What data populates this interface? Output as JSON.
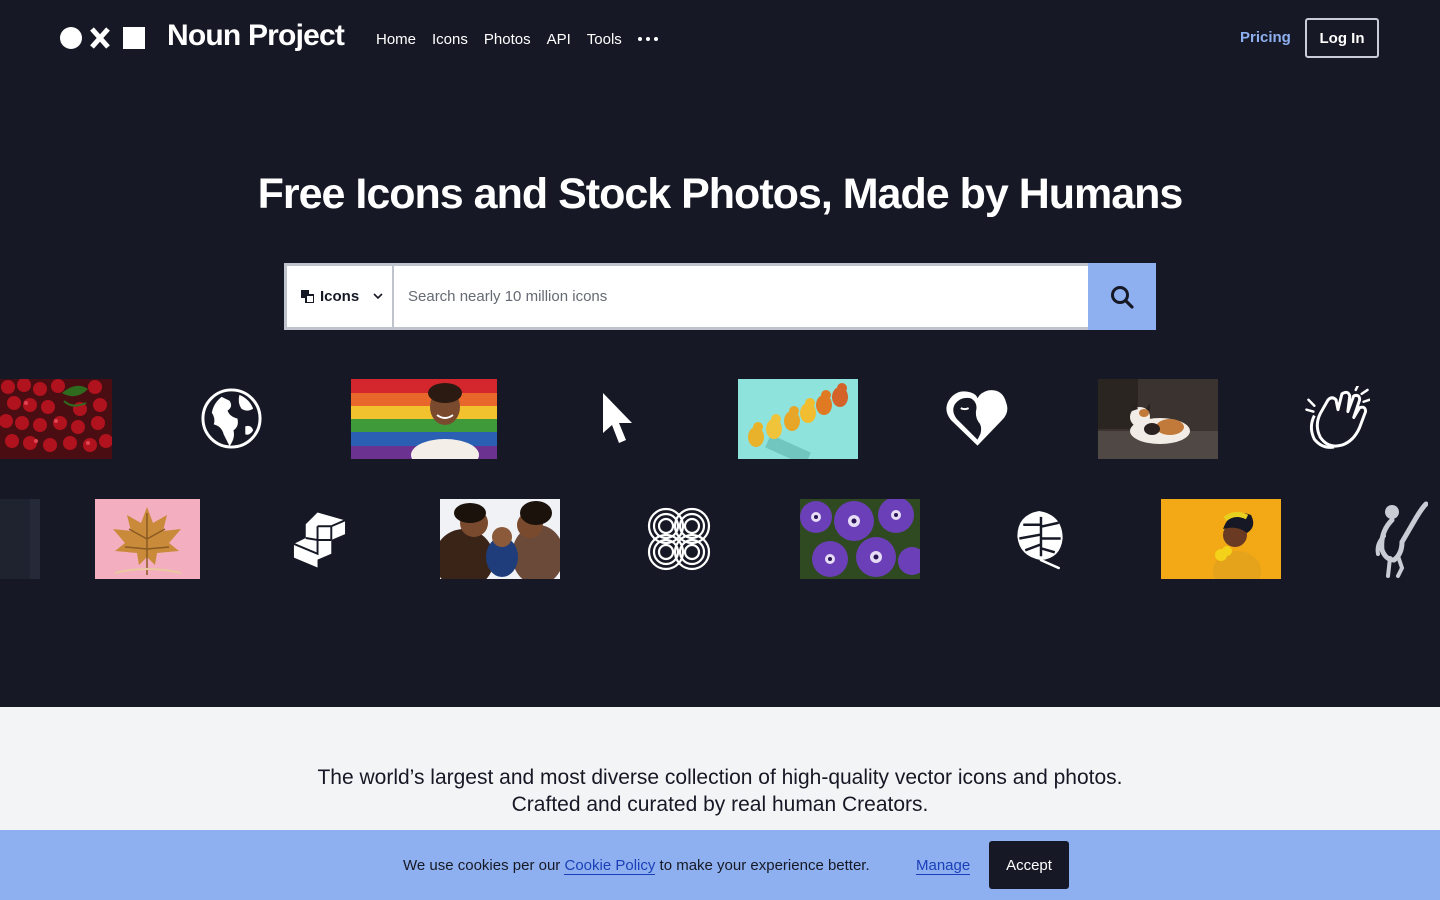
{
  "header": {
    "brand": "Noun Project",
    "nav": [
      "Home",
      "Icons",
      "Photos",
      "API",
      "Tools"
    ],
    "pricing": "Pricing",
    "login": "Log In"
  },
  "hero": {
    "headline": "Free Icons and Stock Photos, Made by Humans",
    "search": {
      "type_label": "Icons",
      "placeholder": "Search nearly 10 million icons"
    }
  },
  "gallery": {
    "row1": [
      "cherries-photo",
      "globe-icon",
      "pride-flag-portrait-photo",
      "cursor-arrow-icon",
      "pears-photo",
      "heart-face-icon",
      "calico-cat-photo",
      "clapping-hands-icon"
    ],
    "row2": [
      "dark-tile-photo",
      "autumn-leaf-photo",
      "blocks-icon",
      "family-with-baby-photo",
      "knot-pattern-icon",
      "purple-petunias-photo",
      "monstera-leaf-icon",
      "woman-yellow-background-photo",
      "dancer-icon"
    ]
  },
  "tagline": {
    "line1": "The world’s largest and most diverse collection of high-quality vector icons and photos.",
    "line2": "Crafted and curated by real human Creators."
  },
  "cookie": {
    "prefix": "We use cookies per our ",
    "link": "Cookie Policy",
    "suffix": " to make your experience better.",
    "manage": "Manage",
    "accept": "Accept"
  },
  "colors": {
    "hero_bg": "#161925",
    "accent": "#8fb0f0",
    "band_bg": "#f3f4f6",
    "text_dark": "#161925"
  }
}
